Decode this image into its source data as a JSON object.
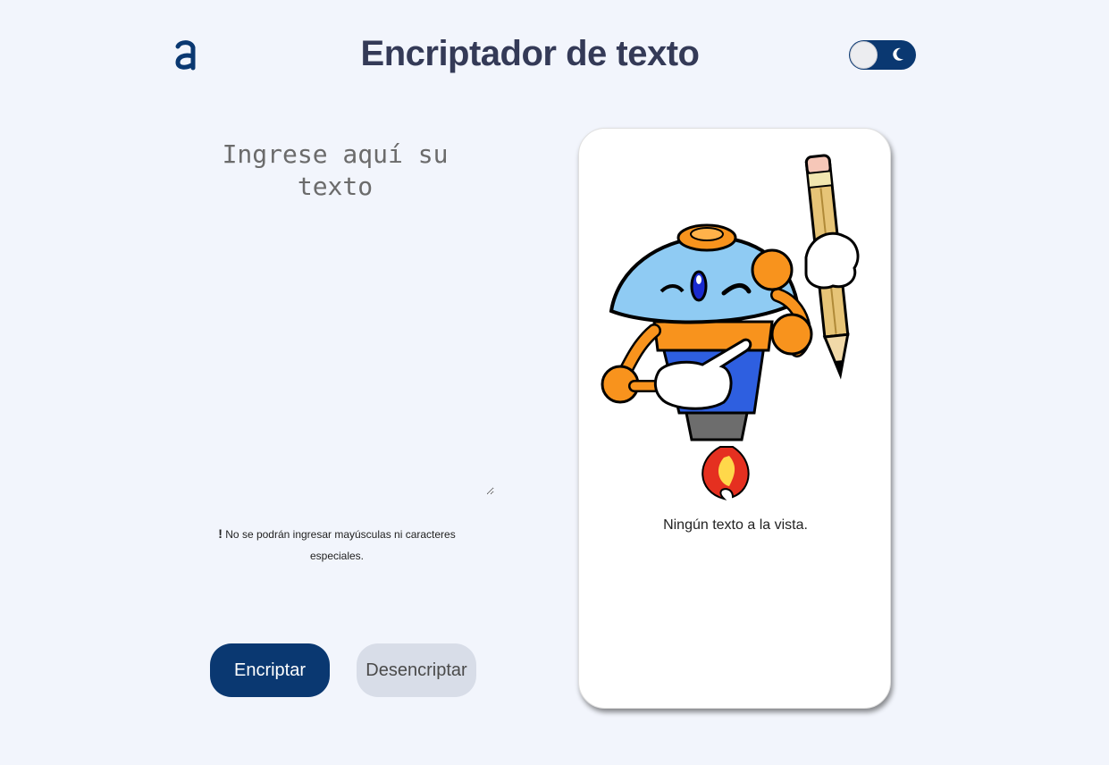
{
  "header": {
    "logo_icon": "alura-logo-icon",
    "title": "Encriptador de texto",
    "theme_toggle_icon": "moon-icon"
  },
  "input": {
    "placeholder": "Ingrese aquí su texto"
  },
  "warning": {
    "mark": "!",
    "text": "No se podrán ingresar mayúsculas ni caracteres especiales."
  },
  "buttons": {
    "encrypt_label": "Encriptar",
    "decrypt_label": "Desencriptar"
  },
  "output": {
    "illustration_icon": "robot-with-pencil-illustration",
    "empty_message": "Ningún texto a la vista."
  },
  "colors": {
    "background": "#f2f5fc",
    "primary": "#0a3871",
    "secondary_button": "#d8dde8",
    "title": "#343a57"
  }
}
